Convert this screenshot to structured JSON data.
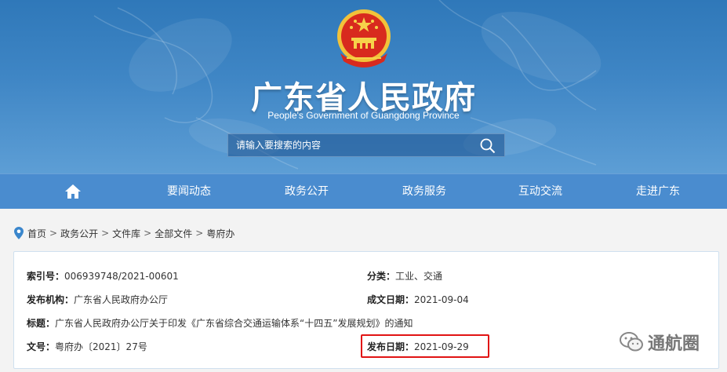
{
  "header": {
    "title": "广东省人民政府",
    "subtitle": "People's Government of Guangdong Province",
    "search_placeholder": "请输入要搜索的内容"
  },
  "nav": {
    "items": [
      "要闻动态",
      "政务公开",
      "政务服务",
      "互动交流",
      "走进广东"
    ]
  },
  "breadcrumb": {
    "items": [
      "首页",
      "政务公开",
      "文件库",
      "全部文件",
      "粤府办"
    ],
    "separator": ">"
  },
  "doc": {
    "index_key": "索引号：",
    "index_val": "006939748/2021-00601",
    "category_key": "分类：",
    "category_val": "工业、交通",
    "publisher_key": "发布机构：",
    "publisher_val": "广东省人民政府办公厅",
    "written_key": "成文日期：",
    "written_val": "2021-09-04",
    "title_key": "标题：",
    "title_val": "广东省人民政府办公厅关于印发《广东省综合交通运输体系“十四五”发展规划》的通知",
    "docno_key": "文号：",
    "docno_val": "粤府办〔2021〕27号",
    "pubdate_key": "发布日期：",
    "pubdate_val": "2021-09-29"
  },
  "watermark": {
    "text": "通航圈"
  },
  "colors": {
    "banner": "#3f86c5",
    "nav": "#4a8ccf",
    "highlight": "#e11414"
  }
}
